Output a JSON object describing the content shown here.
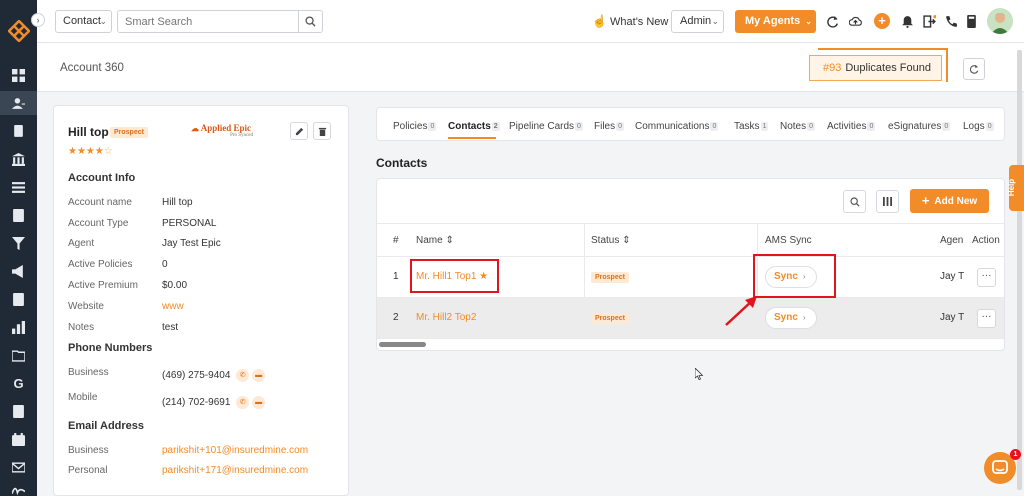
{
  "topbar": {
    "scope_value": "Contact",
    "search_placeholder": "Smart Search",
    "whats_new": "What's New",
    "role_value": "Admin",
    "agents_label": "My Agents"
  },
  "page": {
    "title": "Account 360",
    "duplicates_count": "#93",
    "duplicates_label": "Duplicates Found"
  },
  "account": {
    "name": "Hill top",
    "status": "Prospect",
    "rating": 4,
    "rating_max": 5,
    "stars_filled": "★★★★",
    "stars_empty": "☆",
    "carrier_logo": "Applied Epic",
    "carrier_logo_sub": "Pro Synced",
    "account_info_title": "Account Info",
    "fields": [
      {
        "label": "Account name",
        "value": "Hill top"
      },
      {
        "label": "Account Type",
        "value": "PERSONAL"
      },
      {
        "label": "Agent",
        "value": "Jay Test Epic"
      },
      {
        "label": "Active Policies",
        "value": "0"
      },
      {
        "label": "Active Premium",
        "value": "$0.00"
      },
      {
        "label": "Website",
        "value": "www"
      },
      {
        "label": "Notes",
        "value": "test"
      }
    ],
    "phone_title": "Phone Numbers",
    "phones": [
      {
        "label": "Business",
        "value": "(469) 275-9404"
      },
      {
        "label": "Mobile",
        "value": "(214) 702-9691"
      }
    ],
    "email_title": "Email Address",
    "emails": [
      {
        "label": "Business",
        "value": "parikshit+101@insuredmine.com"
      },
      {
        "label": "Personal",
        "value": "parikshit+171@insuredmine.com"
      }
    ]
  },
  "tabs": [
    {
      "label": "Policies",
      "count": "0"
    },
    {
      "label": "Contacts",
      "count": "2"
    },
    {
      "label": "Pipeline Cards",
      "count": "0"
    },
    {
      "label": "Files",
      "count": "0"
    },
    {
      "label": "Communications",
      "count": "0"
    },
    {
      "label": "Tasks",
      "count": "1"
    },
    {
      "label": "Notes",
      "count": "0"
    },
    {
      "label": "Activities",
      "count": "0"
    },
    {
      "label": "eSignatures",
      "count": "0"
    },
    {
      "label": "Logs",
      "count": "0"
    }
  ],
  "contacts": {
    "section_title": "Contacts",
    "add_label": "Add New",
    "columns": [
      "#",
      "Name ⇕",
      "Status ⇕",
      "AMS Sync",
      "Agen",
      "Action"
    ],
    "rows": [
      {
        "num": "1",
        "name": "Mr. Hill1 Top1 ★",
        "status": "Prospect",
        "sync": "Sync",
        "agent": "Jay T",
        "action": "···"
      },
      {
        "num": "2",
        "name": "Mr. Hill2 Top2",
        "status": "Prospect",
        "sync": "Sync",
        "agent": "Jay T",
        "action": "···"
      }
    ]
  },
  "help_label": "Help",
  "chat_badge": "1",
  "colors": {
    "accent": "#f28c28",
    "sidebar": "#1f2a36",
    "annotation": "#e3141d"
  }
}
